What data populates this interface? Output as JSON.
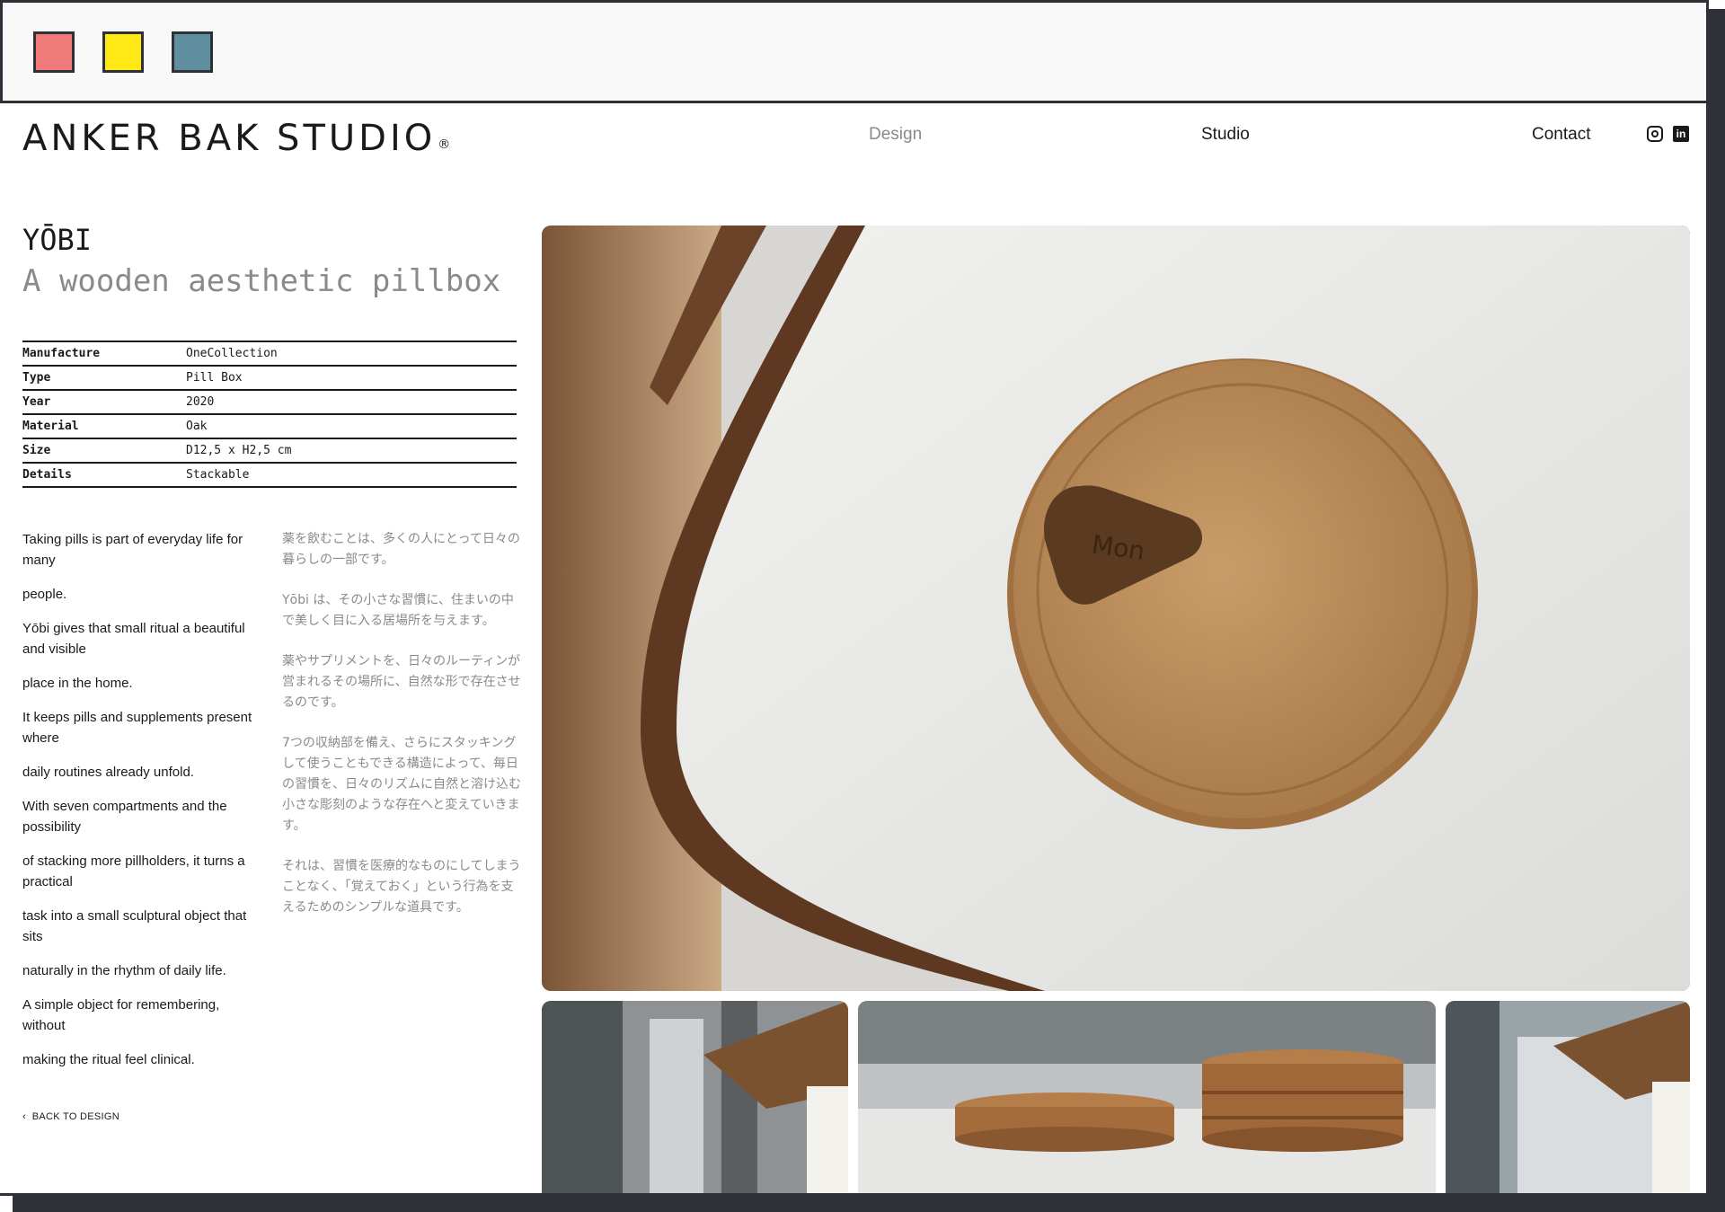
{
  "window": {
    "controls": [
      {
        "name": "red",
        "color": "#f07a7a"
      },
      {
        "name": "yellow",
        "color": "#ffe816"
      },
      {
        "name": "blue",
        "color": "#5f8e9e"
      }
    ]
  },
  "header": {
    "brand": "ANKER BAK STUDIO",
    "brand_mark": "®",
    "nav": {
      "design": "Design",
      "studio": "Studio",
      "contact": "Contact"
    },
    "social": {
      "instagram_icon": "instagram-icon",
      "linkedin_icon": "linkedin-icon",
      "linkedin_glyph": "in"
    }
  },
  "product": {
    "name": "YŌBI",
    "tagline": "A wooden aesthetic pillbox",
    "specs": [
      {
        "key": "Manufacture",
        "value": "OneCollection"
      },
      {
        "key": "Type",
        "value": "Pill Box"
      },
      {
        "key": "Year",
        "value": "2020"
      },
      {
        "key": "Material",
        "value": "Oak"
      },
      {
        "key": "Size",
        "value": "D12,5 x H2,5 cm"
      },
      {
        "key": "Details",
        "value": "Stackable"
      }
    ],
    "description_en": [
      "Taking pills is part of everyday life for many",
      "people.",
      "Yōbi gives that small ritual a beautiful and visible",
      "place in the home.",
      "It keeps pills and supplements present where",
      "daily routines already unfold.",
      "With seven compartments and the possibility",
      "of stacking more pillholders, it turns a practical",
      "task into a small sculptural object that sits",
      "naturally in the rhythm of daily life.",
      "A simple object for remembering, without",
      "making the ritual feel clinical."
    ],
    "description_jp": [
      "薬を飲むことは、多くの人にとって日々の暮らしの一部です。",
      "Yōbi は、その小さな習慣に、住まいの中で美しく目に入る居場所を与えます。",
      "薬やサプリメントを、日々のルーティンが営まれるその場所に、自然な形で存在させるのです。",
      "7つの収納部を備え、さらにスタッキングして使うこともできる構造によって、毎日の習慣を、日々のリズムに自然と溶け込む小さな彫刻のような存在へと変えていきます。",
      "それは、習慣を医療的なものにしてしまうことなく、「覚えておく」という行為を支えるためのシンプルな道具です。"
    ],
    "lid_text": "Mon",
    "back_link": "BACK TO DESIGN"
  },
  "images": {
    "hero": "pillbox-on-table-photo",
    "thumbs": [
      "plant-window-photo",
      "stacked-pillboxes-photo",
      "plant-window-photo-2"
    ]
  }
}
